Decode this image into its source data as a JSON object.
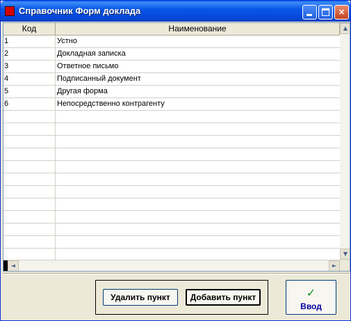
{
  "window": {
    "title": "Справочник Форм доклада",
    "icon": "red-square-icon",
    "controls": {
      "minimize": "minimize-icon",
      "maximize": "maximize-icon",
      "close": "×"
    }
  },
  "table": {
    "columns": [
      "Код",
      "Наименование"
    ],
    "rows": [
      {
        "kod": "1",
        "name": "Устно"
      },
      {
        "kod": "2",
        "name": "Докладная записка"
      },
      {
        "kod": "3",
        "name": "Ответное письмо"
      },
      {
        "kod": "4",
        "name": "Подписанный документ"
      },
      {
        "kod": "5",
        "name": "Другая форма"
      },
      {
        "kod": "6",
        "name": "Непосредственно контрагенту"
      },
      {
        "kod": "",
        "name": ""
      },
      {
        "kod": "",
        "name": ""
      },
      {
        "kod": "",
        "name": ""
      },
      {
        "kod": "",
        "name": ""
      },
      {
        "kod": "",
        "name": ""
      },
      {
        "kod": "",
        "name": ""
      },
      {
        "kod": "",
        "name": ""
      },
      {
        "kod": "",
        "name": ""
      },
      {
        "kod": "",
        "name": ""
      },
      {
        "kod": "",
        "name": ""
      },
      {
        "kod": "",
        "name": ""
      },
      {
        "kod": "",
        "name": ""
      }
    ],
    "scroll": {
      "up": "▲",
      "down": "▼",
      "left": "◄",
      "right": "►"
    }
  },
  "buttons": {
    "delete": "Удалить пункт",
    "add": "Добавить пункт",
    "ok_icon": "✓",
    "ok": "Ввод"
  },
  "colors": {
    "titlebar": "#0957e6",
    "window_bg": "#ece9d8",
    "ok_check": "#0f8f20",
    "ok_label": "#0000a0"
  }
}
